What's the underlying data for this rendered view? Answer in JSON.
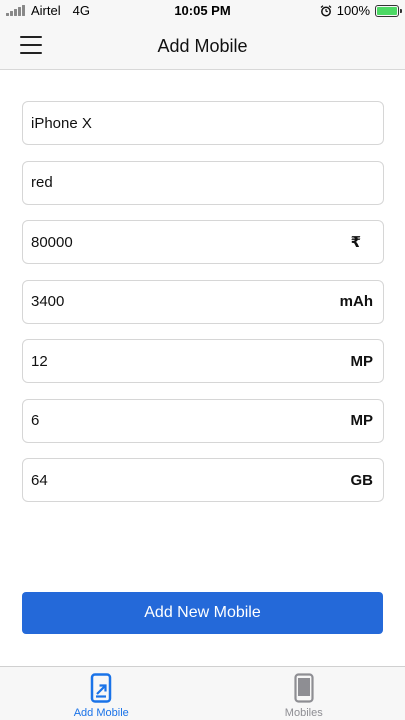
{
  "status_bar": {
    "carrier": "Airtel",
    "network": "4G",
    "time": "10:05 PM",
    "battery_text": "100%",
    "battery_level": 1.0,
    "icons": [
      "signal-icon",
      "alarm-icon",
      "battery-icon"
    ]
  },
  "header": {
    "title": "Add Mobile",
    "menu_icon": "hamburger-menu-icon"
  },
  "form": {
    "fields": [
      {
        "name": "model",
        "value": "iPhone X",
        "unit": ""
      },
      {
        "name": "color",
        "value": "red",
        "unit": ""
      },
      {
        "name": "price",
        "value": "80000",
        "unit": "₹"
      },
      {
        "name": "battery",
        "value": "3400",
        "unit": "mAh"
      },
      {
        "name": "rear-camera",
        "value": "12",
        "unit": "MP"
      },
      {
        "name": "front-camera",
        "value": "6",
        "unit": "MP"
      },
      {
        "name": "storage",
        "value": "64",
        "unit": "GB"
      }
    ],
    "submit_label": "Add New Mobile"
  },
  "tab_bar": {
    "tabs": [
      {
        "label": "Add Mobile",
        "icon": "add-mobile-icon",
        "active": true
      },
      {
        "label": "Mobiles",
        "icon": "mobile-phone-icon",
        "active": false
      }
    ]
  },
  "colors": {
    "accent": "#2469d9",
    "active_tab": "#1a73e8",
    "inactive_tab": "#8e8e93",
    "battery_fill": "#4cd964"
  }
}
